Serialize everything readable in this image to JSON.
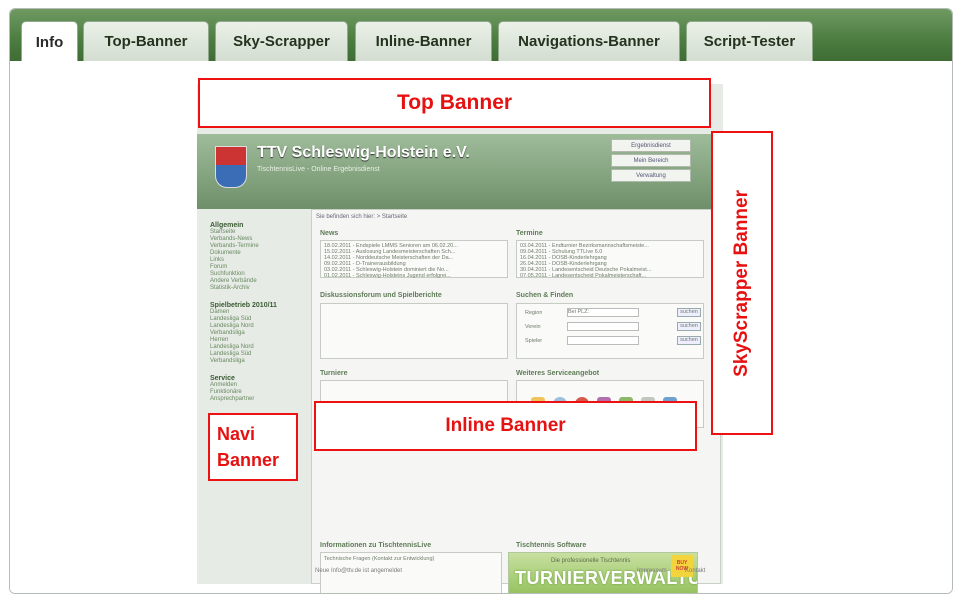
{
  "tabs": [
    {
      "label": "Info",
      "active": true
    },
    {
      "label": "Top-Banner",
      "active": false
    },
    {
      "label": "Sky-Scrapper",
      "active": false
    },
    {
      "label": "Inline-Banner",
      "active": false
    },
    {
      "label": "Navigations-Banner",
      "active": false
    },
    {
      "label": "Script-Tester",
      "active": false
    }
  ],
  "annotations": {
    "top": "Top Banner",
    "skyscrapper": "SkyScrapper Banner",
    "inline": "Inline Banner",
    "navi_line1": "Navi",
    "navi_line2": "Banner"
  },
  "site": {
    "title": "TTV Schleswig-Holstein e.V.",
    "subtitle": "TischtennisLive - Online Ergebnisdienst",
    "header_buttons": [
      "Ergebnisdienst",
      "Mein Bereich",
      "Verwaltung"
    ],
    "breadcrumb": "Sie befinden sich hier: > Startseite",
    "sidebar": [
      {
        "heading": "Allgemein",
        "items": [
          "Startseite",
          "Verbands-News",
          "Verbands-Termine",
          "Dokumente",
          "Links",
          "Forum",
          "Suchfunktion",
          "Andere Verbände",
          "Statistik-Archiv"
        ]
      },
      {
        "heading": "Spielbetrieb 2010/11",
        "items": [
          "Damen",
          "Landesliga Süd",
          "Landesliga Nord",
          "Verbandsliga",
          "Herren",
          "Landesliga Nord",
          "Landesliga Süd",
          "Verbandsliga"
        ]
      },
      {
        "heading": "Service",
        "items": [
          "Anmelden",
          "Funktionäre",
          "Ansprechpartner"
        ]
      }
    ],
    "panels": {
      "news_title": "News",
      "news_items": [
        "18.02.2011 - Endspiele LMMS Senioren am 06.02.20...",
        "15.02.2011 - Auslosung Landesmeisterschaften Sch...",
        "14.02.2011 - Norddeutsche Meisterschaften der Da...",
        "09.02.2011 - D-Trainerausbildung",
        "03.02.2011 - Schleswig-Holstein dominiert die No...",
        "01.02.2011 - Schleswig-Holsteins Jugend erfolgrei..."
      ],
      "termine_title": "Termine",
      "termine_items": [
        "03.04.2011 - Endturnier Bezirksmannschaftsmeiste...",
        "09.04.2011 - Schulung TTLive 6.0",
        "16.04.2011 - DOSB-Kinderlehrgang",
        "26.04.2011 - DOSB-Kinderlehrgang",
        "30.04.2011 - Landesentscheid Deutsche Pokalmeist...",
        "07.05.2011 - Landesentscheid Pokalmeisterschaft..."
      ],
      "diskussion_title": "Diskussionsforum und Spielberichte",
      "suchen_title": "Suchen & Finden",
      "suchen_rows": [
        {
          "label": "Region",
          "value": "Bei PLZ:",
          "button": "suchen"
        },
        {
          "label": "Verein",
          "value": "",
          "button": "suchen"
        },
        {
          "label": "Spieler",
          "value": "",
          "button": "suchen"
        }
      ],
      "turniere_title": "Turniere",
      "service_title": "Weiteres Serviceangebot",
      "infos_title": "Informationen zu TischtennisLive",
      "infos_items": [
        "Technische Fragen (Kontakt zur Entwicklung)"
      ],
      "software_title": "Tischtennis Software",
      "software_small": "Die professionelle Tischtennis",
      "software_big": "TURNIERVERWALTUNG",
      "software_sticker": "BUY NOW"
    },
    "footer_left": "Neue Info@ttv.de ist angemeldet",
    "footer_right_1": "Impressum",
    "footer_right_2": "Kontakt"
  },
  "colors": {
    "tabbar": "#4c7c40",
    "annotation": "#e11111"
  }
}
